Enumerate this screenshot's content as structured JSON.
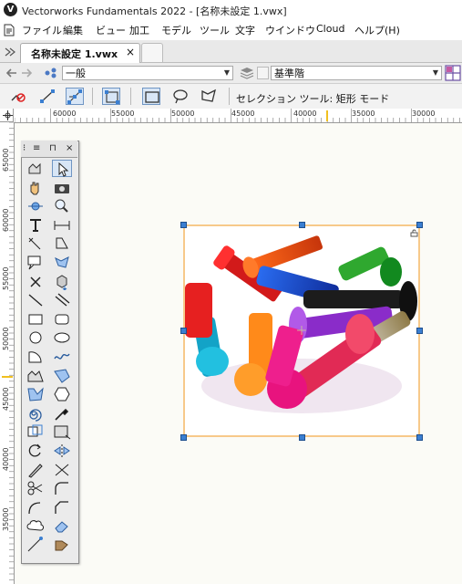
{
  "window": {
    "title": "Vectorworks Fundamentals 2022 - [名称未設定 1.vwx]",
    "app_icon": "V"
  },
  "menubar": {
    "items": [
      "ファイル",
      "編集",
      "ビュー",
      "加工",
      "モデル",
      "ツール",
      "文字",
      "ウインドウ",
      "Cloud",
      "ヘルプ(H)"
    ]
  },
  "tabs": {
    "active_label": "名称未設定 1.vwx",
    "close_glyph": "×"
  },
  "classbar": {
    "class_value": "一般",
    "layer_value": "基準階"
  },
  "modebar": {
    "mode_label": "セレクション ツール: 矩形 モード"
  },
  "rulers": {
    "horizontal_labels": [
      "60000",
      "55000",
      "50000",
      "45000",
      "40000",
      "35000",
      "30000"
    ],
    "vertical_labels": [
      "65000",
      "60000",
      "55000",
      "50000",
      "45000",
      "40000",
      "35000"
    ]
  },
  "palette": {
    "buttons": [
      "⁝",
      "≡",
      "⊓",
      "×"
    ],
    "tools": [
      "fillet-tool-icon",
      "selection-tool-icon",
      "pan-tool-icon",
      "camera-tool-icon",
      "flyover-tool-icon",
      "zoom-tool-icon",
      "text-tool-icon",
      "dimension-tool-icon",
      "angle-dimension-icon",
      "clip-tool-icon",
      "callout-tool-icon",
      "reshape-tool-icon",
      "delete-tool-icon",
      "push-pull-tool-icon",
      "line-tool-icon",
      "double-line-tool-icon",
      "rectangle-tool-icon",
      "rounded-rectangle-tool-icon",
      "circle-tool-icon",
      "oval-tool-icon",
      "arc-tool-icon",
      "freehand-tool-icon",
      "polyline-tool-icon",
      "polygon-tool-icon",
      "shape-tool-icon",
      "hexagon-tool-icon",
      "spiral-tool-icon",
      "eyedropper-tool-icon",
      "offset-tool-icon",
      "attribute-mapping-icon",
      "rotate-tool-icon",
      "mirror-tool-icon",
      "knife-tool-icon",
      "trim-tool-icon",
      "scissors-tool-icon",
      "fillet-corner-icon",
      "connect-tool-icon",
      "chamfer-tool-icon",
      "cloud-tool-icon",
      "eraser-tool-icon",
      "locus-tool-icon",
      "symbol-tool-icon"
    ]
  },
  "colors": {
    "accent": "#3b7fd1",
    "image_border": "#f7c98a",
    "selection_highlight": "#d8e6f6"
  }
}
